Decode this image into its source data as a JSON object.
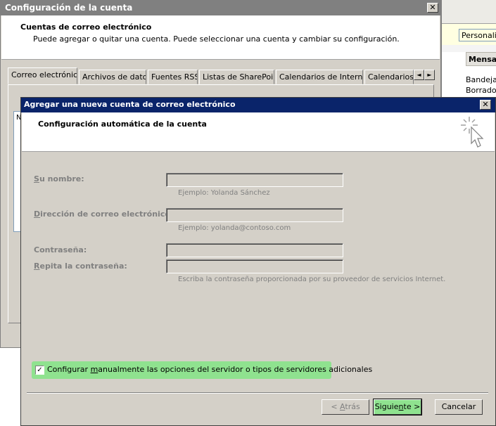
{
  "background_window": {
    "toolbar_field": "Personaliza",
    "header": "Mensa",
    "items": [
      "Bandeja",
      "Borrador"
    ]
  },
  "account_window": {
    "title": "Configuración de la cuenta",
    "close": "✕",
    "heading": "Cuentas de correo electrónico",
    "description": "Puede agregar o quitar una cuenta. Puede seleccionar una cuenta y cambiar su configuración.",
    "tabs": [
      "Correo electrónico",
      "Archivos de datos",
      "Fuentes RSS",
      "Listas de SharePoint",
      "Calendarios de Internet",
      "Calendarios p"
    ],
    "scroll_left": "◄",
    "scroll_right": "►",
    "list_header": "N"
  },
  "dialog": {
    "title": "Agregar una nueva cuenta de correo electrónico",
    "close": "✕",
    "heading": "Configuración automática de la cuenta",
    "name_label": {
      "key": "S",
      "rest": "u nombre:"
    },
    "name_value": "",
    "name_hint": "Ejemplo: Yolanda Sánchez",
    "email_label": {
      "key": "D",
      "rest": "irección de correo electrónico:"
    },
    "email_value": "",
    "email_hint": "Ejemplo: yolanda@contoso.com",
    "password_label": "Contraseña:",
    "password_value": "",
    "repeat_label": {
      "key": "R",
      "rest": "epita la contraseña:"
    },
    "repeat_value": "",
    "password_hint": "Escriba la contraseña proporcionada por su proveedor de servicios Internet.",
    "manual_checked": true,
    "manual_check_glyph": "✓",
    "manual_label": {
      "pre": "Configurar ",
      "key": "m",
      "post": "anualmente las opciones del servidor o tipos de servidores adicionales"
    },
    "back_button": {
      "pre": "< ",
      "key": "A",
      "post": "trás"
    },
    "next_button": {
      "pre": "Siguie",
      "key": "n",
      "post": "te >"
    },
    "cancel_button": "Cancelar"
  },
  "colors": {
    "highlight": "#8fe28f",
    "active_title": "#0a246a",
    "inactive_title": "#808080",
    "face": "#d4d0c8"
  }
}
